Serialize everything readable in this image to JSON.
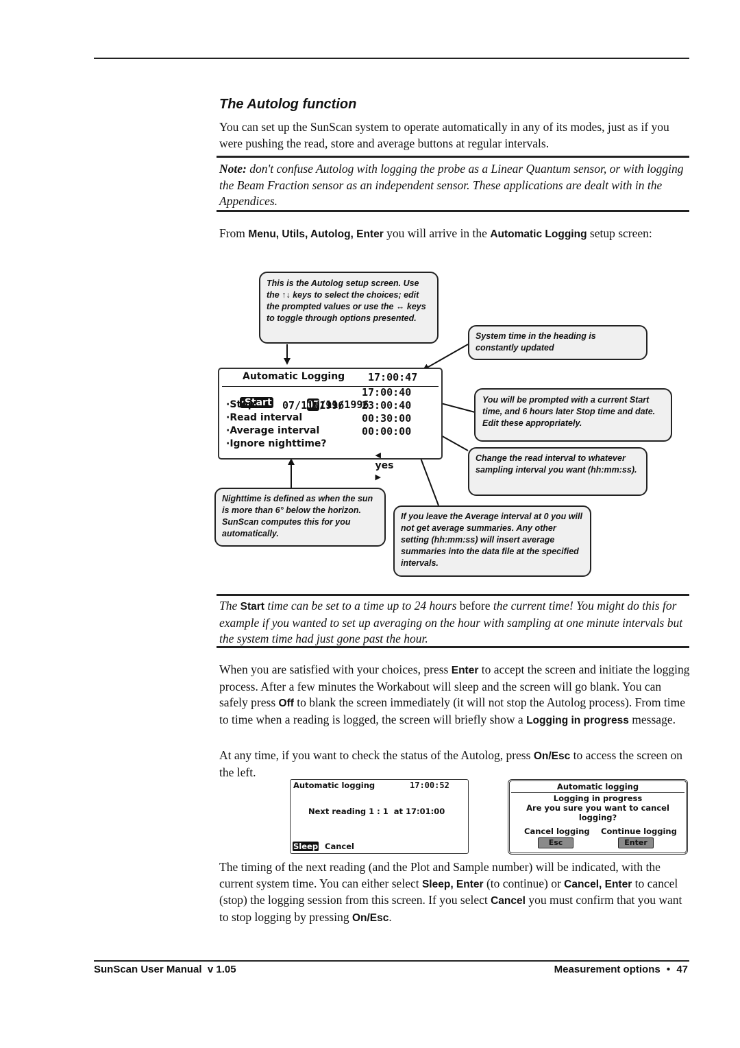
{
  "section": {
    "title": "The Autolog function",
    "intro": "You can set up the SunScan system to operate automatically in any of its modes, just as if you were pushing the read, store and average buttons at regular intervals."
  },
  "note": {
    "label": "Note:",
    "text": " don't confuse Autolog with logging the probe as a Linear Quantum sensor, or with logging the Beam Fraction sensor as an independent sensor. These applications are dealt with in the Appendices."
  },
  "from_para": {
    "p1": "From ",
    "menu_path": "Menu, Utils, Autolog, Enter",
    "p2": " you will arrive in the ",
    "screen_name": "Automatic Logging",
    "p3": " setup screen:"
  },
  "setup_screen": {
    "title": "Automatic Logging",
    "clock": "17:00:47",
    "rows": [
      {
        "label": "·Start",
        "date_sel": "07",
        "date_rest": "/11/1996",
        "time": "17:00:40"
      },
      {
        "label": "·Stop",
        "date": "07/11/1996",
        "time": "23:00:40"
      },
      {
        "label": "·Read interval",
        "value": "00:30:00"
      },
      {
        "label": "·Average interval",
        "value": "00:00:00"
      },
      {
        "label": "·Ignore nighttime?",
        "left_arrow": "🡄",
        "value": "yes",
        "right_arrow": "🡆"
      }
    ]
  },
  "callouts": {
    "setup": "This is the Autolog setup screen. Use the ↑↓ keys to select the choices; edit the prompted values or use the ↔ keys to toggle through options presented.",
    "system_time": "System time in the heading is constantly updated",
    "prompted": "You will be prompted with a current Start time, and 6 hours later Stop time and date. Edit these appropriately.",
    "read_interval": "Change the read interval to whatever sampling interval you want (hh:mm:ss).",
    "nighttime": "Nighttime is defined as when the sun is more than 6° below the horizon. SunScan computes this for you automatically.",
    "average": "If you leave the Average interval at 0 you will not get average summaries. Any other setting  (hh:mm:ss) will insert average summaries into the data file at the specified intervals."
  },
  "start_note": {
    "p1": "The ",
    "start": "Start",
    "p2": " time can be set to a time up to 24 hours ",
    "before": "before",
    "p3": " the current time! You might do this for example if you wanted to set up averaging on the hour with sampling at one minute intervals but the system time had just gone past the hour."
  },
  "satisfied_para": {
    "p1": "When you are satisfied with your choices, press ",
    "enter": "Enter",
    "p2": " to accept the screen and initiate the logging process. After a few minutes the Workabout will sleep and the screen will go blank. You can safely press ",
    "off": "Off",
    "p3": " to blank the screen immediately (it will not stop the Autolog process). From time to time when a reading is logged, the screen will briefly show a ",
    "logging": "Logging in progress",
    "p4": " message."
  },
  "status_para": {
    "p1": "At any time, if you want to check the status of the Autolog, press ",
    "key": "On/Esc",
    "p2": " to access the screen on the left."
  },
  "status_screen": {
    "title": "Automatic logging",
    "clock": "17:00:52",
    "next_reading": "Next reading 1 : 1  at 17:01:00",
    "sleep": "Sleep",
    "cancel": "Cancel"
  },
  "cancel_dialog": {
    "title": "Automatic logging",
    "line1": "Logging in progress",
    "line2": "Are you sure you want to cancel",
    "line3": "logging?",
    "cancel_label": "Cancel logging",
    "continue_label": "Continue logging",
    "esc_key": "Esc",
    "enter_key": "Enter"
  },
  "timing_para": {
    "p1": "The timing of the next reading (and the Plot and Sample number) will be indicated, with the current system time. You can either select ",
    "sleep_enter": "Sleep, Enter",
    "p2": " (to continue) or ",
    "cancel_enter": "Cancel, Enter",
    "p3": " to cancel (stop) the logging session from this screen. If you select ",
    "cancel": "Cancel",
    "p4": " you must confirm that you want to stop logging by pressing ",
    "key": "On/Esc",
    "p5": "."
  },
  "footer": {
    "left": "SunScan User Manual  v 1.05",
    "right_section": "Measurement options",
    "bullet": "•",
    "page_number": "47"
  }
}
